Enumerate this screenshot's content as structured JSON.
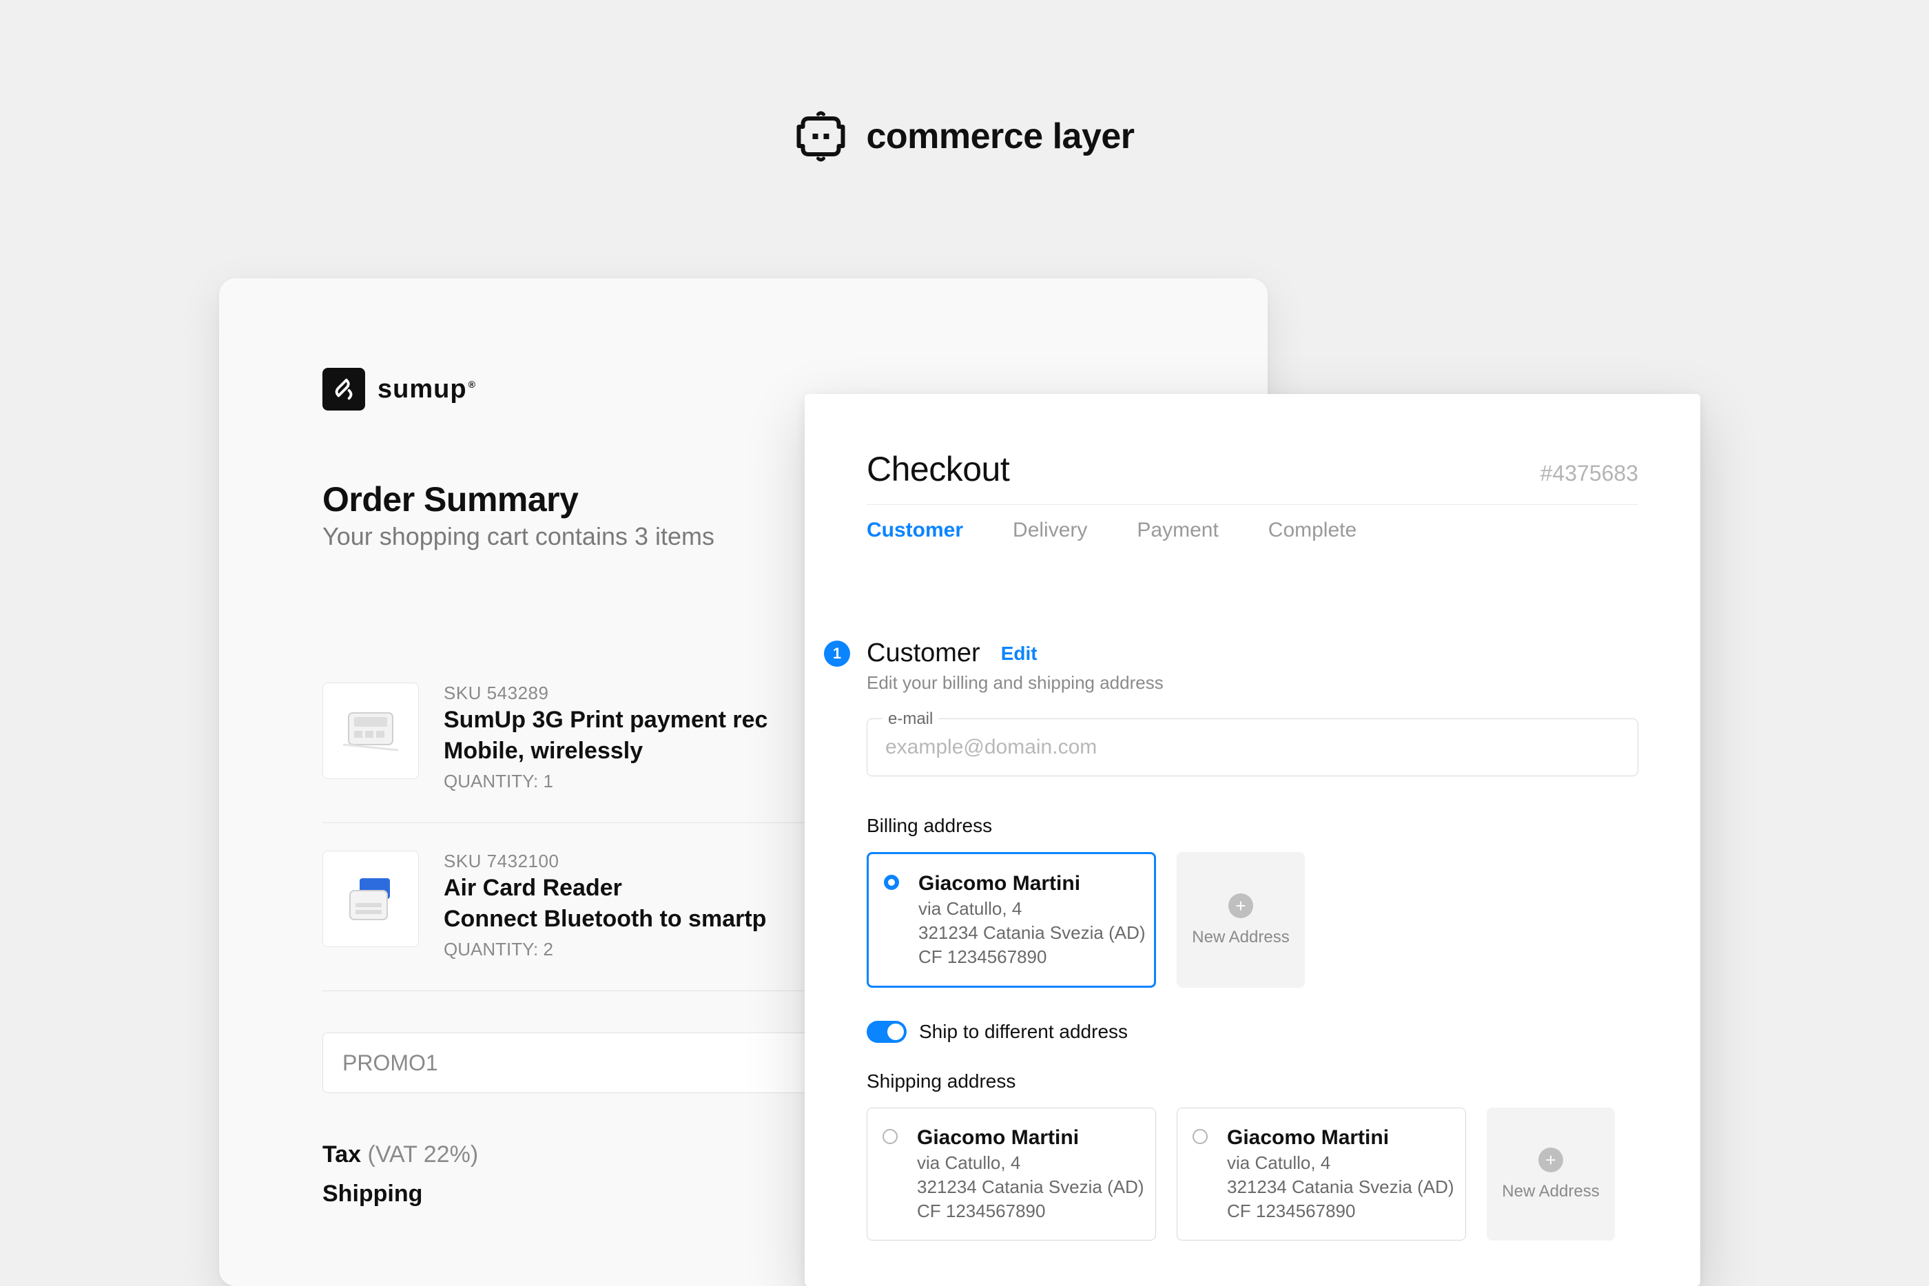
{
  "brand": {
    "name": "commerce layer"
  },
  "order_summary": {
    "merchant": "sumup",
    "title": "Order Summary",
    "subtitle": "Your shopping cart contains 3 items",
    "items": [
      {
        "sku_label": "SKU 543289",
        "name_line1": "SumUp 3G Print payment rec",
        "name_line2": "Mobile, wirelessly",
        "qty_label": "QUANTITY: 1"
      },
      {
        "sku_label": "SKU 7432100",
        "name_line1": "Air Card Reader",
        "name_line2": "Connect Bluetooth to smartp",
        "qty_label": "QUANTITY: 2"
      }
    ],
    "promo_value": "PROMO1",
    "totals": {
      "tax_label": "Tax",
      "tax_note": "(VAT 22%)",
      "shipping_label": "Shipping"
    }
  },
  "checkout": {
    "title": "Checkout",
    "order_id": "#4375683",
    "steps": {
      "customer": "Customer",
      "delivery": "Delivery",
      "payment": "Payment",
      "complete": "Complete"
    },
    "customer_section": {
      "step_number": "1",
      "title": "Customer",
      "edit_label": "Edit",
      "subtitle": "Edit your billing and shipping address",
      "email_label": "e-mail",
      "email_placeholder": "example@domain.com",
      "billing_label": "Billing address",
      "ship_diff_label": "Ship to different address",
      "shipping_label": "Shipping address",
      "new_address_label": "New Address",
      "billing_addresses": [
        {
          "name": "Giacomo Martini",
          "line1": "via Catullo, 4",
          "line2": "321234 Catania Svezia (AD)",
          "line3": "CF 1234567890",
          "selected": true
        }
      ],
      "shipping_addresses": [
        {
          "name": "Giacomo Martini",
          "line1": "via Catullo, 4",
          "line2": "321234 Catania Svezia (AD)",
          "line3": "CF 1234567890",
          "selected": false
        },
        {
          "name": "Giacomo Martini",
          "line1": "via Catullo, 4",
          "line2": "321234 Catania Svezia (AD)",
          "line3": "CF 1234567890",
          "selected": false
        }
      ]
    }
  }
}
